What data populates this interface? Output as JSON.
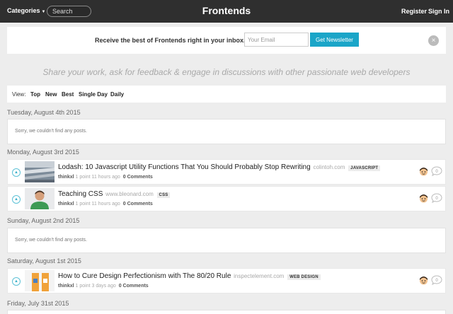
{
  "header": {
    "categories_label": "Categories",
    "search_placeholder": "Search",
    "title": "Frontends",
    "register": "Register",
    "sign_in": "Sign In"
  },
  "newsletter": {
    "text": "Receive the best of Frontends right in your inbox.",
    "email_placeholder": "Your Email",
    "button": "Get Newsletter",
    "close": "×"
  },
  "tagline": "Share your work, ask for feedback & engage in discussions with other passionate web developers",
  "view": {
    "label": "View:",
    "options": [
      "Top",
      "New",
      "Best",
      "Single Day",
      "Daily"
    ]
  },
  "days": [
    {
      "date": "Tuesday, August 4th 2015",
      "empty_text": "Sorry, we couldn't find any posts."
    },
    {
      "date": "Monday, August 3rd 2015"
    },
    {
      "date": "Sunday, August 2nd 2015",
      "empty_text": "Sorry, we couldn't find any posts."
    },
    {
      "date": "Saturday, August 1st 2015"
    },
    {
      "date": "Friday, July 31st 2015"
    }
  ],
  "posts": [
    {
      "title": "Lodash: 10 Javascript Utility Functions That You Should Probably Stop Rewriting",
      "domain": "colintoh.com",
      "tag": "JAVASCRIPT",
      "user": "thinkxl",
      "meta": "1 point 11 hours ago",
      "comments": "0 Comments"
    },
    {
      "title": "Teaching CSS",
      "domain": "www.bleonard.com",
      "tag": "CSS",
      "user": "thinkxl",
      "meta": "1 point 11 hours ago",
      "comments": "0 Comments"
    },
    {
      "title": "How to Cure Design Perfectionism with The 80/20 Rule",
      "domain": "inspectelement.com",
      "tag": "WEB DESIGN",
      "user": "thinkxl",
      "meta": "1 point 3 days ago",
      "comments": "0 Comments"
    }
  ],
  "icons": {
    "upvote": "chevron-up-icon",
    "comment": "comment-bubble-icon",
    "avatar": "user-avatar-icon"
  },
  "colors": {
    "topbar": "#2f2f2f",
    "accent": "#1aa5c8",
    "background": "#ededed"
  }
}
